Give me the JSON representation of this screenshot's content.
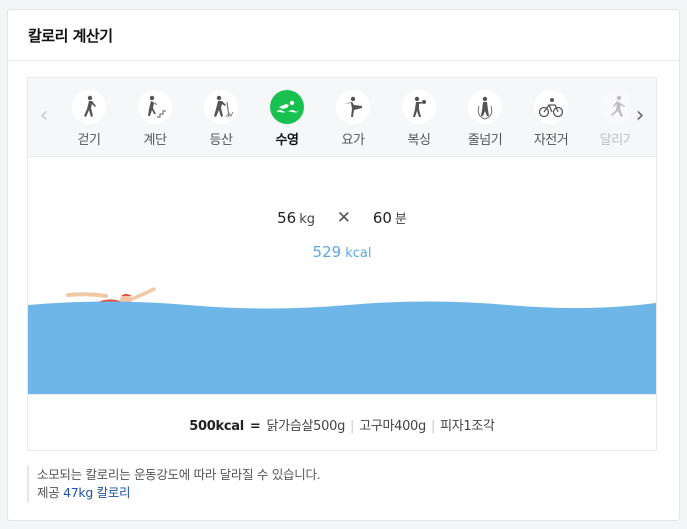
{
  "card": {
    "title": "칼로리 계산기"
  },
  "tabs": [
    {
      "label": "걷기",
      "icon": "walking-icon",
      "active": false
    },
    {
      "label": "계단",
      "icon": "stairs-icon",
      "active": false
    },
    {
      "label": "등산",
      "icon": "hiking-icon",
      "active": false
    },
    {
      "label": "수영",
      "icon": "swimming-icon",
      "active": true
    },
    {
      "label": "요가",
      "icon": "yoga-icon",
      "active": false
    },
    {
      "label": "복싱",
      "icon": "boxing-icon",
      "active": false
    },
    {
      "label": "줄넘기",
      "icon": "jump-rope-icon",
      "active": false
    },
    {
      "label": "자전거",
      "icon": "cycling-icon",
      "active": false
    },
    {
      "label": "달리기",
      "icon": "running-icon",
      "active": false
    }
  ],
  "nav": {
    "prev_icon": "chevron-left-icon",
    "next_icon": "chevron-right-icon"
  },
  "calc": {
    "weight": "56",
    "weight_unit": "kg",
    "times_icon": "times-icon",
    "minutes": "60",
    "minutes_unit": "분",
    "kcal": "529",
    "kcal_unit": "kcal"
  },
  "equivalent": {
    "amount": "500kcal",
    "equals": "=",
    "items": [
      "닭가슴살500g",
      "고구마400g",
      "피자1조각"
    ]
  },
  "notes": {
    "line1": "소모되는 칼로리는 운동강도에 따라 달라질 수 있습니다.",
    "provider_prefix": "제공",
    "provider_link": "47kg 칼로리"
  },
  "colors": {
    "active_tab": "#18c14f",
    "water": "#6eb6e8",
    "kcal_text": "#5aa9e6",
    "link": "#1f54a8"
  }
}
